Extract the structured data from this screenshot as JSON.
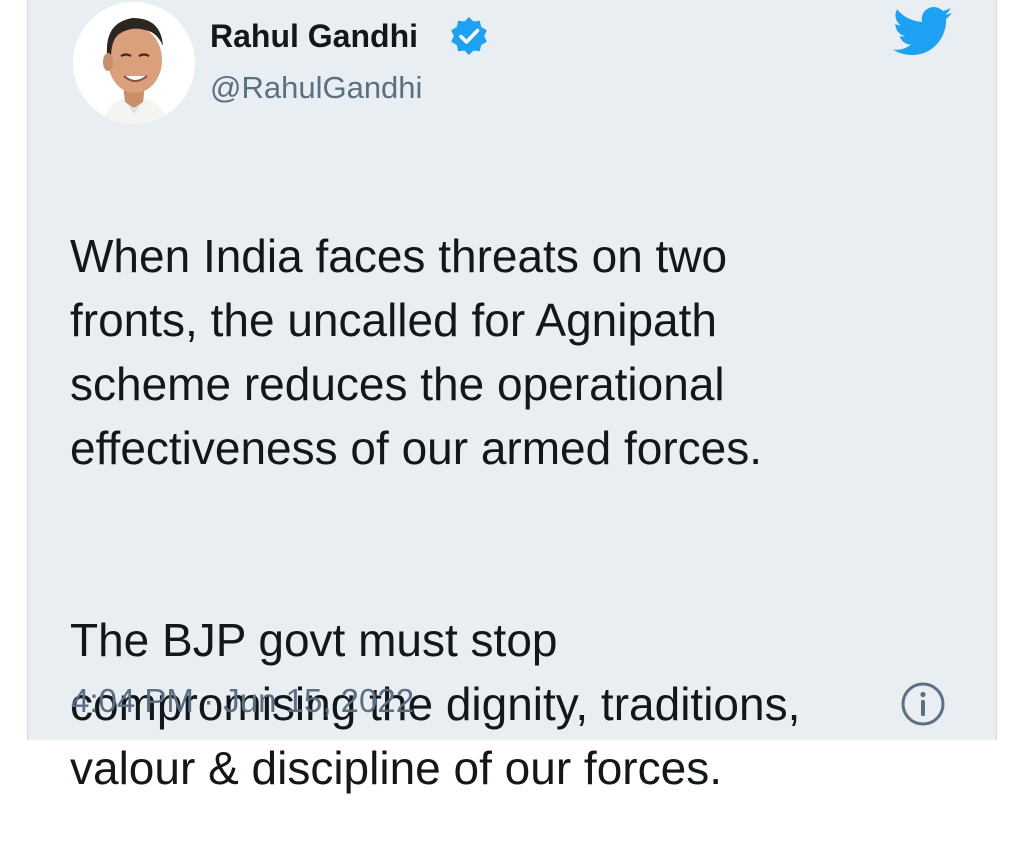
{
  "tweet": {
    "author": {
      "display_name": "Rahul Gandhi",
      "handle": "@RahulGandhi",
      "verified": true
    },
    "paragraphs": [
      "When India faces threats on two\nfronts, the uncalled for Agnipath\nscheme reduces the operational\neffectiveness of our armed forces.",
      "The BJP govt must stop\ncompromising the dignity, traditions,\nvalour & discipline of our forces."
    ],
    "time": "4:04 PM",
    "separator": " · ",
    "date": "Jun 15, 2022"
  },
  "icons": {
    "brand": "twitter-bird-icon",
    "verified": "verified-badge-icon",
    "info": "info-icon"
  },
  "colors": {
    "card_background": "#e9eef3",
    "twitter_blue": "#1da1f2",
    "text_primary": "#14171a",
    "text_secondary": "#5b7083"
  }
}
